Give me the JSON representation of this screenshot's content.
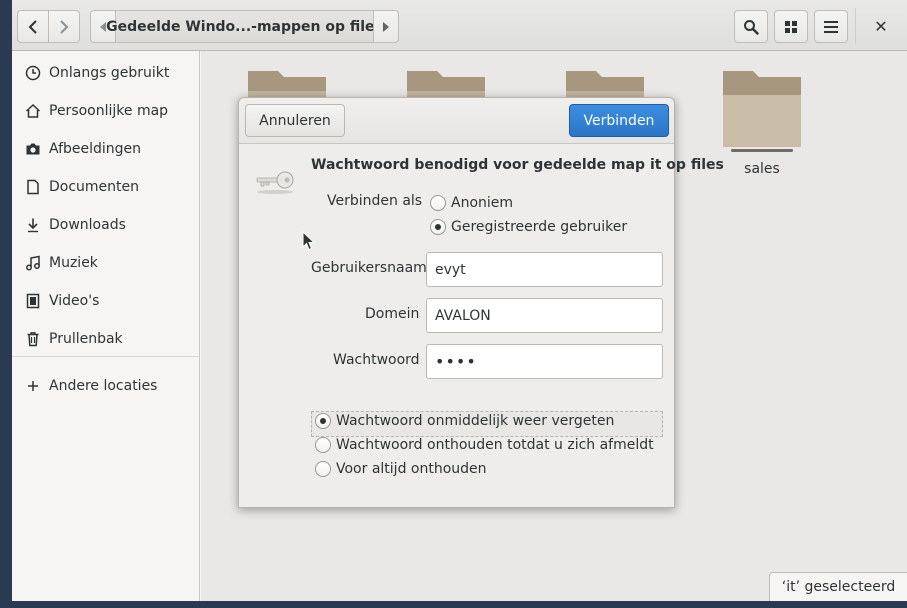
{
  "header": {
    "breadcrumb": "Gedeelde Windo...-mappen op files",
    "close_label": "✕"
  },
  "sidebar": {
    "items": [
      {
        "label": "Onlangs gebruikt",
        "icon": "clock-icon"
      },
      {
        "label": "Persoonlijke map",
        "icon": "home-icon"
      },
      {
        "label": "Afbeeldingen",
        "icon": "camera-icon"
      },
      {
        "label": "Documenten",
        "icon": "document-icon"
      },
      {
        "label": "Downloads",
        "icon": "download-icon"
      },
      {
        "label": "Muziek",
        "icon": "music-icon"
      },
      {
        "label": "Video's",
        "icon": "video-icon"
      },
      {
        "label": "Prullenbak",
        "icon": "trash-icon"
      }
    ],
    "other_locations": "Andere locaties"
  },
  "content": {
    "folders": [
      {
        "label": ""
      },
      {
        "label": ""
      },
      {
        "label": ""
      },
      {
        "label": "sales"
      }
    ],
    "status": "‘it’ geselecteerd"
  },
  "dialog": {
    "cancel_label": "Annuleren",
    "connect_label": "Verbinden",
    "title": "Wachtwoord benodigd voor gedeelde map it op files",
    "connect_as_label": "Verbinden als",
    "connect_as_options": [
      {
        "label": "Anoniem",
        "selected": false
      },
      {
        "label": "Geregistreerde gebruiker",
        "selected": true
      }
    ],
    "username_label": "Gebruikersnaam",
    "username_value": "evyt",
    "domain_label": "Domein",
    "domain_value": "AVALON",
    "password_label": "Wachtwoord",
    "password_value": "••••",
    "remember_options": [
      {
        "label": "Wachtwoord onmiddelijk weer vergeten",
        "selected": true
      },
      {
        "label": "Wachtwoord onthouden totdat u zich afmeldt",
        "selected": false
      },
      {
        "label": "Voor altijd onthouden",
        "selected": false
      }
    ]
  },
  "colors": {
    "accent": "#2a76c6",
    "folder": "#b5a68d",
    "desktop": "#2a3a52"
  }
}
